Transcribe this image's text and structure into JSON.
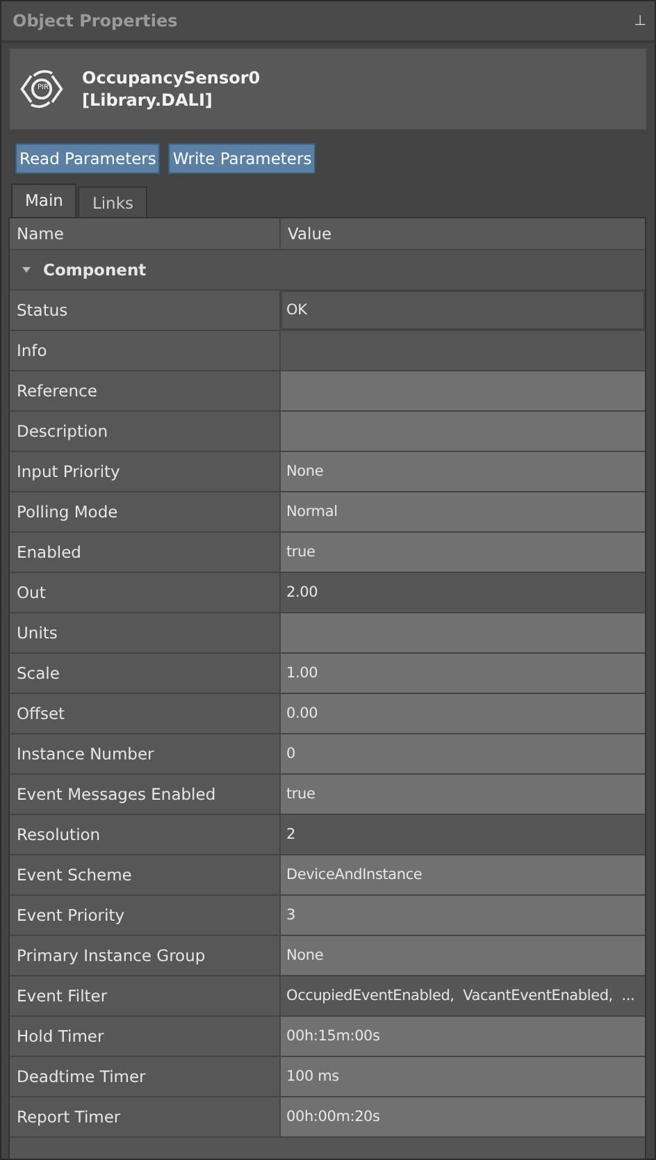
{
  "panel": {
    "title": "Object Properties",
    "pin": "⊥"
  },
  "object": {
    "name": "OccupancySensor0",
    "library": "[Library.DALI]",
    "icon_label": "PIR"
  },
  "buttons": [
    "Read Parameters",
    "Write Parameters"
  ],
  "tabs": [
    {
      "label": "Main",
      "selected": true
    },
    {
      "label": "Links",
      "selected": false
    }
  ],
  "table": {
    "columns": [
      "Name",
      "Value"
    ],
    "group": {
      "label": "Component",
      "expanded": true
    },
    "rows": [
      {
        "name": "Status",
        "value": "OK",
        "readonly": true,
        "focused": true
      },
      {
        "name": "Info",
        "readonly": true,
        "focused": false
      },
      {
        "name": "Reference",
        "readonly": false,
        "focused": false
      },
      {
        "name": "Description",
        "readonly": false,
        "focused": false
      },
      {
        "name": "Input Priority",
        "value": "None",
        "readonly": false,
        "focused": false
      },
      {
        "name": "Polling Mode",
        "value": "Normal",
        "readonly": false,
        "focused": false
      },
      {
        "name": "Enabled",
        "value": "true",
        "readonly": false,
        "focused": false
      },
      {
        "name": "Out",
        "value": "2.00",
        "readonly": true,
        "focused": false
      },
      {
        "name": "Units",
        "readonly": false,
        "focused": false
      },
      {
        "name": "Scale",
        "value": "1.00",
        "readonly": false,
        "focused": false
      },
      {
        "name": "Offset",
        "value": "0.00",
        "readonly": false,
        "focused": false
      },
      {
        "name": "Instance Number",
        "value": "0",
        "readonly": false,
        "focused": false
      },
      {
        "name": "Event Messages Enabled",
        "value": "true",
        "readonly": false,
        "focused": false
      },
      {
        "name": "Resolution",
        "value": "2",
        "readonly": true,
        "focused": false
      },
      {
        "name": "Event Scheme",
        "value": "DeviceAndInstance",
        "readonly": false,
        "focused": false
      },
      {
        "name": "Event Priority",
        "value": "3",
        "readonly": false,
        "focused": false
      },
      {
        "name": "Primary Instance Group",
        "value": "None",
        "readonly": false,
        "focused": false
      },
      {
        "name": "Event Filter",
        "value": "OccupiedEventEnabled,  VacantEventEnabled,  ...",
        "readonly": true,
        "focused": false
      },
      {
        "name": "Hold Timer",
        "value": "00h:15m:00s",
        "readonly": false,
        "focused": false
      },
      {
        "name": "Deadtime Timer",
        "value": "100 ms",
        "readonly": false,
        "focused": false
      },
      {
        "name": "Report Timer",
        "value": "00h:00m:20s",
        "readonly": false,
        "focused": false
      }
    ]
  }
}
